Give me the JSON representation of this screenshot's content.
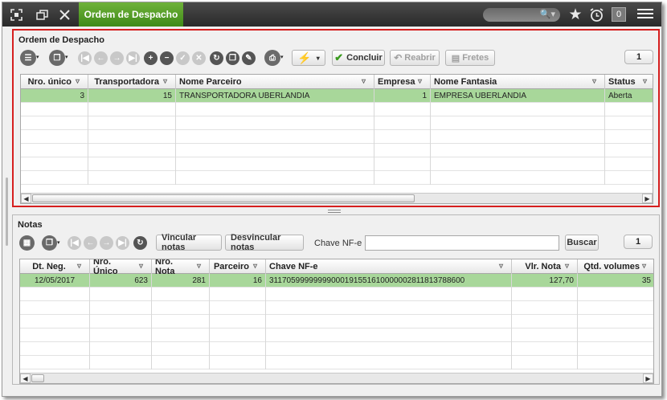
{
  "topbar": {
    "tab_title": "Ordem de Despacho",
    "search_placeholder": "",
    "notification_count": "0",
    "colors": {
      "tab_green": "#4f9a24",
      "bar_dark": "#333333"
    }
  },
  "despacho": {
    "title": "Ordem de Despacho",
    "buttons": {
      "concluir": "Concluir",
      "reabrir": "Reabrir",
      "fretes": "Fretes"
    },
    "page": "1",
    "columns": [
      "Nro. único",
      "Transportadora",
      "Nome Parceiro",
      "Empresa",
      "Nome Fantasia",
      "Status"
    ],
    "rows": [
      {
        "nro_unico": "3",
        "transportadora": "15",
        "nome_parceiro": "TRANSPORTADORA UBERLANDIA",
        "empresa": "1",
        "nome_fantasia": "EMPRESA UBERLANDIA",
        "status": "Aberta"
      }
    ]
  },
  "notas": {
    "title": "Notas",
    "buttons": {
      "vincular": "Vincular notas",
      "desvincular": "Desvincular notas",
      "buscar": "Buscar"
    },
    "chave_label": "Chave NF-e",
    "chave_value": "",
    "page": "1",
    "columns": [
      "Dt. Neg.",
      "Nro. Único",
      "Nro. Nota",
      "Parceiro",
      "Chave NF-e",
      "Vlr. Nota",
      "Qtd. volumes"
    ],
    "rows": [
      {
        "dt_neg": "12/05/2017",
        "nro_unico": "623",
        "nro_nota": "281",
        "parceiro": "16",
        "chave": "31170599999999000191551610000002811813788600",
        "vlr_nota": "127,70",
        "qtd_volumes": "35"
      }
    ]
  },
  "icons": [
    "fit-screen-icon",
    "restore-window-icon",
    "close-icon",
    "search-icon",
    "star-icon",
    "alarm-icon",
    "menu-icon",
    "lightning-icon",
    "print-icon",
    "check-icon",
    "undo-icon",
    "filter-icon"
  ]
}
